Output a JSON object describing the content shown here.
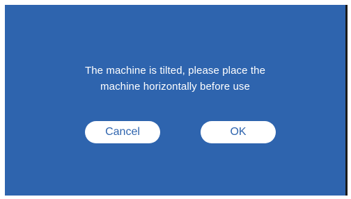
{
  "dialog": {
    "message_line1": "The machine is tilted, please place the",
    "message_line2": "machine horizontally before use",
    "cancel_label": "Cancel",
    "ok_label": "OK"
  },
  "colors": {
    "background": "#2e64ae",
    "button_bg": "#ffffff",
    "button_text": "#2e64ae",
    "message_text": "#ffffff"
  }
}
